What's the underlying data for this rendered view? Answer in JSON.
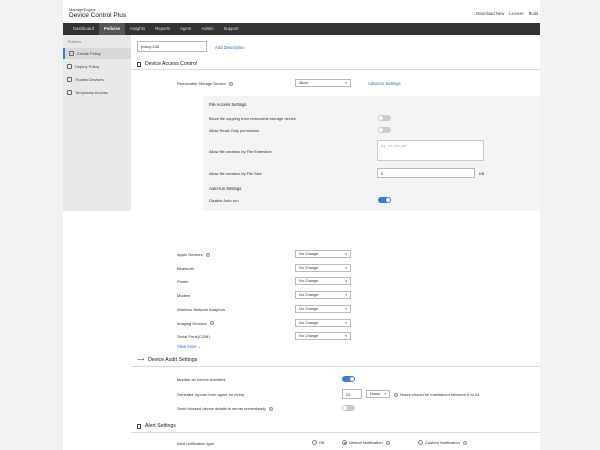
{
  "header": {
    "logo_top": "ManageEngine",
    "logo_main": "Device Control Plus",
    "links": [
      "Download New",
      "License",
      "Build"
    ]
  },
  "nav": {
    "items": [
      "Dashboard",
      "Policies",
      "Insights",
      "Reports",
      "Agent",
      "Admin",
      "Support"
    ],
    "active": "Policies"
  },
  "sidebar": {
    "title": "Policies",
    "items": [
      "Create Policy",
      "Deploy Policy",
      "Trusted Devices",
      "Temporary Access"
    ]
  },
  "policy": {
    "name_value": "policy-246",
    "add_description": "Add Description"
  },
  "device_access": {
    "title": "Device Access Control",
    "removable_label": "Removable Storage Device",
    "removable_value": "Allow",
    "advance_settings": "Advance Settings",
    "file_access_heading": "File Access Settings",
    "block_copy_label": "Block file copying from removable storage device",
    "read_only_label": "Allow Read-Only permission",
    "ext_label": "Allow file creation by File Extension",
    "ext_placeholder": "Eg: .txt,.doc,.pdf",
    "size_label": "Allow file creation by File Size",
    "size_value": "0",
    "size_unit": "KB",
    "autorun_heading": "Auto-run Settings",
    "autorun_label": "Disable Auto-run",
    "toggles": {
      "block_copy": false,
      "read_only": false,
      "autorun": true
    }
  },
  "devices": {
    "rows": [
      {
        "label": "Apple Devices",
        "value": "No Change",
        "help": true
      },
      {
        "label": "Bluetooth",
        "value": "No Change",
        "help": false
      },
      {
        "label": "Printer",
        "value": "No Change",
        "help": false
      },
      {
        "label": "Modem",
        "value": "No Change",
        "help": false
      },
      {
        "label": "Wireless Network Adaptors",
        "value": "No Change",
        "help": false
      },
      {
        "label": "Imaging Devices",
        "value": "No Change",
        "help": true
      },
      {
        "label": "Serial Ports(COM)",
        "value": "No Change",
        "help": false
      }
    ],
    "view_more": "View more"
  },
  "audit": {
    "title": "Device Audit Settings",
    "monitor_label": "Monitor all Device Activities",
    "generate_label": "Generate reports from agent for every",
    "generate_value": "24",
    "generate_unit": "Hours",
    "hours_note": "Hours should be maintained between 6 to 24",
    "send_label": "Send blocked device details to server immediately",
    "toggles": {
      "monitor": true,
      "send": false
    }
  },
  "alerts": {
    "title": "Alert Settings",
    "type_label": "Alert notification type",
    "options": [
      "Off",
      "Default Notification",
      "Custom Notification"
    ],
    "selected": "Default Notification"
  },
  "colors": {
    "accent": "#3a7bd5",
    "nav_bg": "#333333",
    "link": "#2a6cc7"
  }
}
